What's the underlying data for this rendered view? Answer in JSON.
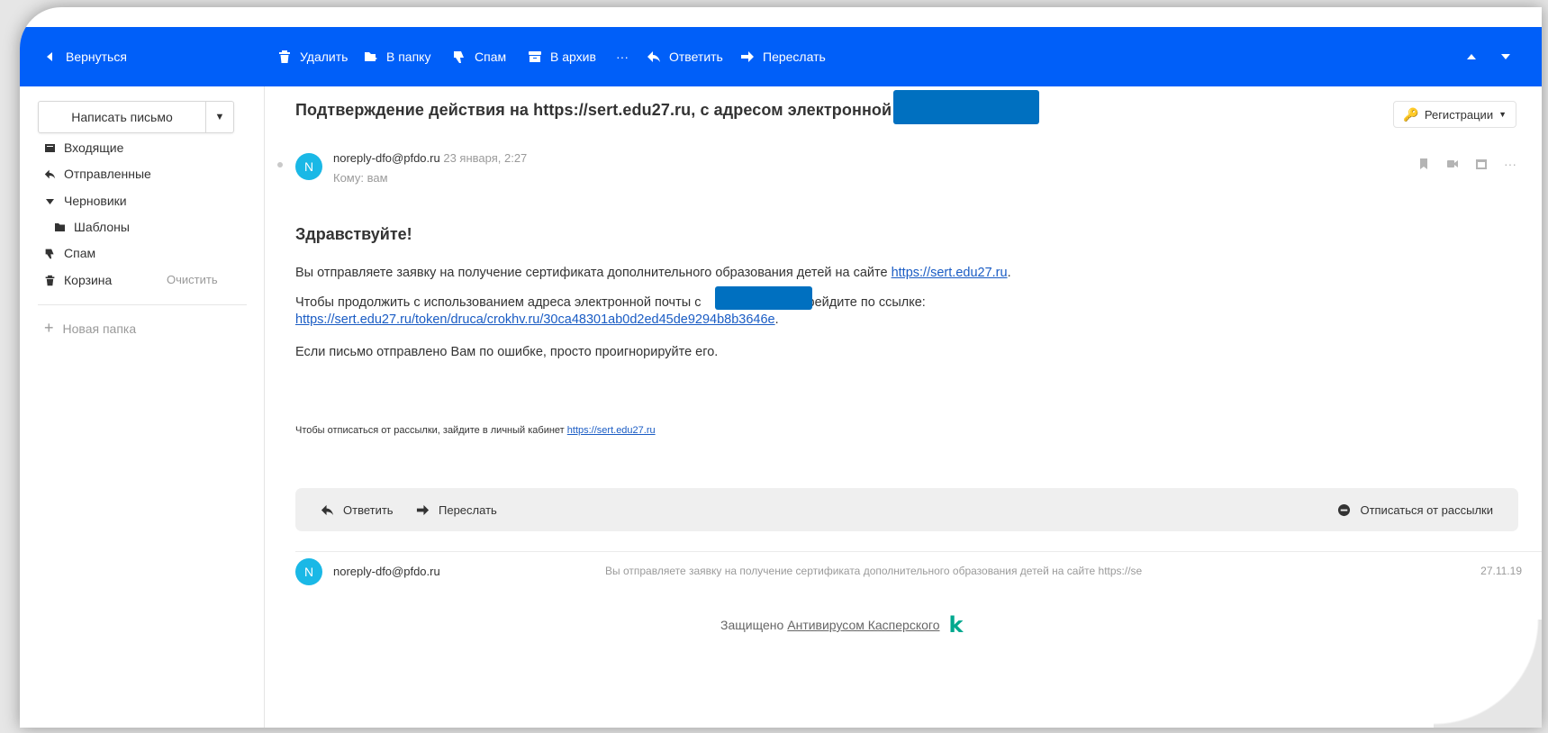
{
  "toolbar": {
    "back": "Вернуться",
    "delete": "Удалить",
    "to_folder": "В папку",
    "spam": "Спам",
    "archive": "В архив",
    "more": "···",
    "reply": "Ответить",
    "forward": "Переслать"
  },
  "sidebar": {
    "compose": "Написать письмо",
    "folders": [
      {
        "label": "Входящие",
        "icon": "inbox-icon"
      },
      {
        "label": "Отправленные",
        "icon": "sent-arrow-icon"
      },
      {
        "label": "Черновики",
        "icon": "chevron-down-icon"
      },
      {
        "label": "Шаблоны",
        "icon": "folder-icon"
      },
      {
        "label": "Спам",
        "icon": "thumbs-down-icon"
      },
      {
        "label": "Корзина",
        "icon": "trash-icon"
      }
    ],
    "clear": "Очистить",
    "new_folder": "Новая папка"
  },
  "message": {
    "subject": "Подтверждение действия на https://sert.edu27.ru, с адресом электронной почты",
    "tag_button": "Регистрации",
    "avatar_letter": "N",
    "from": "noreply-dfo@pfdo.ru",
    "date": "23 января, 2:27",
    "to": "Кому: вам",
    "greeting": "Здравствуйте!",
    "p1_text": "Вы отправляете заявку на получение сертификата дополнительного образования детей на сайте ",
    "p1_link": "https://sert.edu27.ru",
    "p1_end": ".",
    "p2_start": "Чтобы продолжить с использованием адреса электронной почты с",
    "p2_end": "ерейдите по ссылке:",
    "p2_link": "https://sert.edu27.ru/token/druca/crokhv.ru/30ca48301ab0d2ed45de9294b8b3646e",
    "p2_link_end": ".",
    "p3": "Если письмо отправлено Вам по ошибке, просто проигнорируйте его.",
    "unsubscribe_text": "Чтобы отписаться от рассылки, зайдите в личный кабинет ",
    "unsubscribe_link": "https://sert.edu27.ru"
  },
  "actions": {
    "reply": "Ответить",
    "forward": "Переслать",
    "unsubscribe": "Отписаться от рассылки"
  },
  "thread": {
    "avatar_letter": "N",
    "from": "noreply-dfo@pfdo.ru",
    "snippet": "Вы отправляете заявку на получение сертификата дополнительного образования детей на сайте https://se",
    "date": "27.11.19"
  },
  "footer": {
    "protected_text": "Защищено ",
    "protected_link": "Антивирусом Касперского",
    "logo": "k"
  },
  "colors": {
    "toolbar_bg": "#005ff9",
    "avatar": "#1ab8e6",
    "link": "#1a5cc4",
    "redaction": "#0070c0",
    "kaspersky": "#00a88e"
  }
}
